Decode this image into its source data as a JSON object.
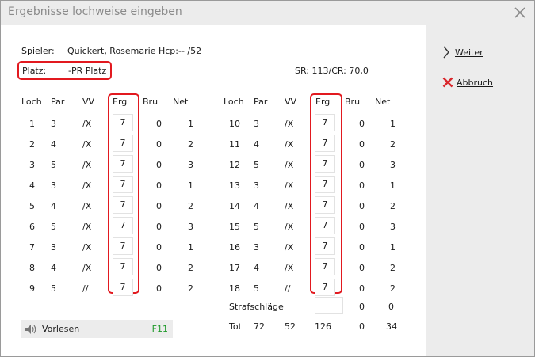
{
  "title": "Ergebnisse lochweise eingeben",
  "player": {
    "label": "Spieler:",
    "value": "Quickert, Rosemarie Hcp:--   /52"
  },
  "course": {
    "label": "Platz:",
    "value": "-PR Platz",
    "rating": "SR: 113/CR: 70,0"
  },
  "columns": {
    "hole": "Loch",
    "par": "Par",
    "vv": "VV",
    "erg": "Erg",
    "bru": "Bru",
    "net": "Net"
  },
  "front_nine": [
    {
      "hole": "1",
      "par": "3",
      "vv": "/X",
      "erg": "7",
      "bru": "0",
      "net": "1"
    },
    {
      "hole": "2",
      "par": "4",
      "vv": "/X",
      "erg": "7",
      "bru": "0",
      "net": "2"
    },
    {
      "hole": "3",
      "par": "5",
      "vv": "/X",
      "erg": "7",
      "bru": "0",
      "net": "3"
    },
    {
      "hole": "4",
      "par": "3",
      "vv": "/X",
      "erg": "7",
      "bru": "0",
      "net": "1"
    },
    {
      "hole": "5",
      "par": "4",
      "vv": "/X",
      "erg": "7",
      "bru": "0",
      "net": "2"
    },
    {
      "hole": "6",
      "par": "5",
      "vv": "/X",
      "erg": "7",
      "bru": "0",
      "net": "3"
    },
    {
      "hole": "7",
      "par": "3",
      "vv": "/X",
      "erg": "7",
      "bru": "0",
      "net": "1"
    },
    {
      "hole": "8",
      "par": "4",
      "vv": "/X",
      "erg": "7",
      "bru": "0",
      "net": "2"
    },
    {
      "hole": "9",
      "par": "5",
      "vv": "//",
      "erg": "7",
      "bru": "0",
      "net": "2"
    }
  ],
  "back_nine": [
    {
      "hole": "10",
      "par": "3",
      "vv": "/X",
      "erg": "7",
      "bru": "0",
      "net": "1"
    },
    {
      "hole": "11",
      "par": "4",
      "vv": "/X",
      "erg": "7",
      "bru": "0",
      "net": "2"
    },
    {
      "hole": "12",
      "par": "5",
      "vv": "/X",
      "erg": "7",
      "bru": "0",
      "net": "3"
    },
    {
      "hole": "13",
      "par": "3",
      "vv": "/X",
      "erg": "7",
      "bru": "0",
      "net": "1"
    },
    {
      "hole": "14",
      "par": "4",
      "vv": "/X",
      "erg": "7",
      "bru": "0",
      "net": "2"
    },
    {
      "hole": "15",
      "par": "5",
      "vv": "/X",
      "erg": "7",
      "bru": "0",
      "net": "3"
    },
    {
      "hole": "16",
      "par": "3",
      "vv": "/X",
      "erg": "7",
      "bru": "0",
      "net": "1"
    },
    {
      "hole": "17",
      "par": "4",
      "vv": "/X",
      "erg": "7",
      "bru": "0",
      "net": "2"
    },
    {
      "hole": "18",
      "par": "5",
      "vv": "//",
      "erg": "7",
      "bru": "0",
      "net": "2"
    }
  ],
  "penalty": {
    "label": "Strafschläge",
    "value": "",
    "bru": "0",
    "net": "0"
  },
  "total": {
    "label": "Tot",
    "par": "72",
    "vv": "52",
    "erg": "126",
    "bru": "0",
    "net": "34"
  },
  "buttons": {
    "next": "Weiter",
    "cancel": "Abbruch"
  },
  "read_aloud": {
    "label": "Vorlesen",
    "key": "F11"
  },
  "colors": {
    "highlight": "#e2191f",
    "shortcut": "#1f9a2a",
    "panel": "#ececec",
    "cancel_icon": "#d9262b"
  }
}
